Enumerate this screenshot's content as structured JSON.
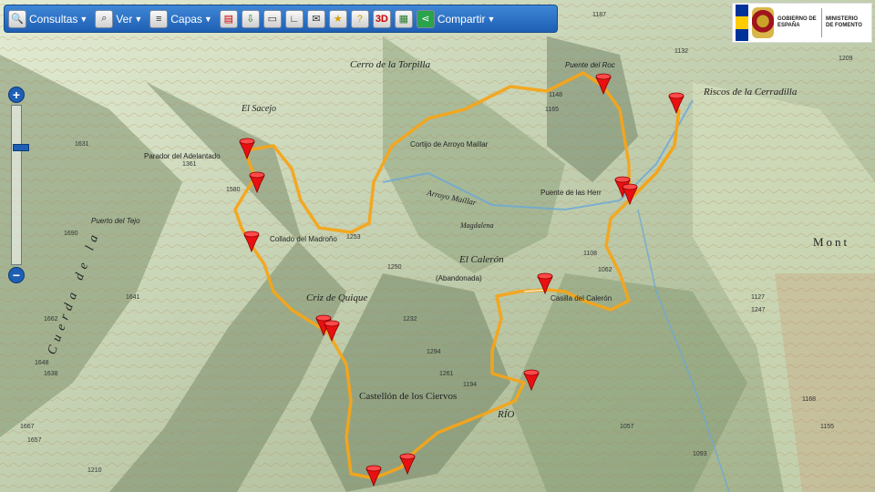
{
  "toolbar": {
    "consultas": "Consultas",
    "ver": "Ver",
    "capas": "Capas",
    "compartir": "Compartir",
    "icons": [
      "print-icon",
      "download-icon",
      "ruler-icon",
      "angle-icon",
      "mail-icon",
      "favorite-icon",
      "help-icon",
      "3d-icon",
      "photo-icon"
    ]
  },
  "gov": {
    "gobierno": "GOBIERNO DE ESPAÑA",
    "ministerio": "MINISTERIO DE FOMENTO"
  },
  "zoom": {
    "in": "+",
    "out": "−",
    "level_fraction": 0.25
  },
  "map": {
    "labels": {
      "cerro": "Cerro de la Torpilla",
      "riscos": "Riscos de la Cerradilla",
      "sacejo": "El Sacejo",
      "parador": "Parador del Adelantado",
      "cortijo": "Cortijo de Arroyo Maillar",
      "puente_herr": "Puente de las Herr",
      "puente_top": "Puente del Roc",
      "collado": "Collado del Madroño",
      "puerto": "Puerto del Tejo",
      "calecon": "El Calerón",
      "abandonada": "(Abandonada)",
      "casilla": "Casilla del Calerón",
      "criz": "Criz de Quique",
      "castellon": "Castellón de los Ciervos",
      "rio": "RÍO",
      "mont": "Mont",
      "cuerda": "Cuerda de la",
      "magdalena": "Magdalena",
      "arroyo": "Arroyo Maillar"
    },
    "spot_heights": [
      "1631",
      "1361",
      "1580",
      "1690",
      "1641",
      "1662",
      "1648",
      "1638",
      "1667",
      "1657",
      "1253",
      "1250",
      "1232",
      "1294",
      "1261",
      "1194",
      "1165",
      "1148",
      "1108",
      "1062",
      "1127",
      "1247",
      "1209",
      "1187",
      "1132",
      "1168",
      "1155",
      "1093",
      "1057",
      "1210"
    ]
  }
}
